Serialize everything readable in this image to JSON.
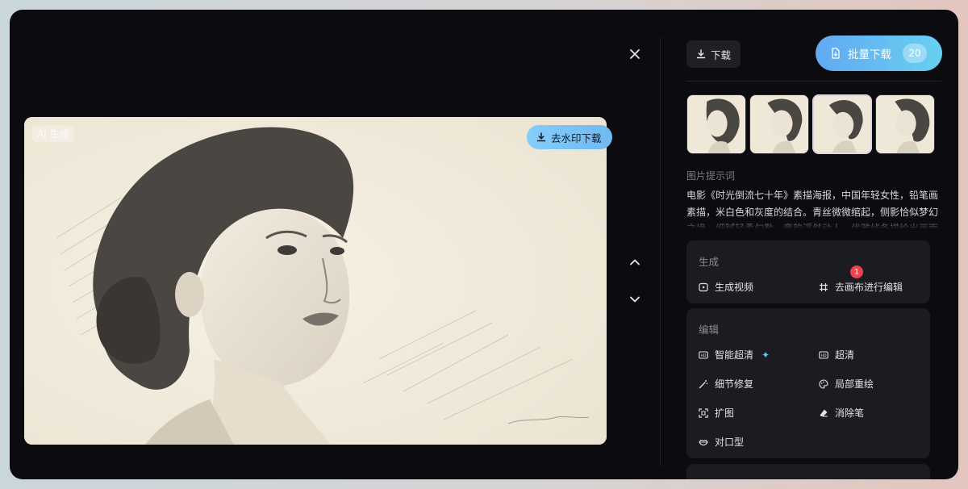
{
  "image": {
    "ai_badge": "AI 生成"
  },
  "actions": {
    "download_no_watermark": "去水印下载",
    "download": "下载",
    "batch_download": "批量下载",
    "batch_count": "20"
  },
  "prompt": {
    "label": "图片提示词",
    "text": "电影《时光倒流七十年》素描海报，中国年轻女性，铅笔画素描，米白色和灰度的结合。青丝微微绾起，侧影恰似梦幻之境，细腻轻柔勾勒，意韵浮然动人，优雅线条描绘出画面"
  },
  "generate": {
    "title": "生成",
    "items": [
      {
        "label": "生成视频",
        "icon": "play-icon"
      },
      {
        "label": "去画布进行编辑",
        "icon": "canvas-icon",
        "badge": "1"
      }
    ]
  },
  "edit": {
    "title": "编辑",
    "items": [
      {
        "label": "智能超清",
        "icon": "hd-plus-icon"
      },
      {
        "label": "超清",
        "icon": "hd-icon"
      },
      {
        "label": "细节修复",
        "icon": "magic-wand-icon"
      },
      {
        "label": "局部重绘",
        "icon": "palette-icon"
      },
      {
        "label": "扩图",
        "icon": "expand-icon"
      },
      {
        "label": "消除笔",
        "icon": "eraser-icon"
      },
      {
        "label": "对口型",
        "icon": "lips-icon"
      }
    ]
  },
  "colors": {
    "accent": "#6fb9f3",
    "badge": "#f0414f",
    "panel": "#1b1c21",
    "background": "#0c0c10"
  }
}
